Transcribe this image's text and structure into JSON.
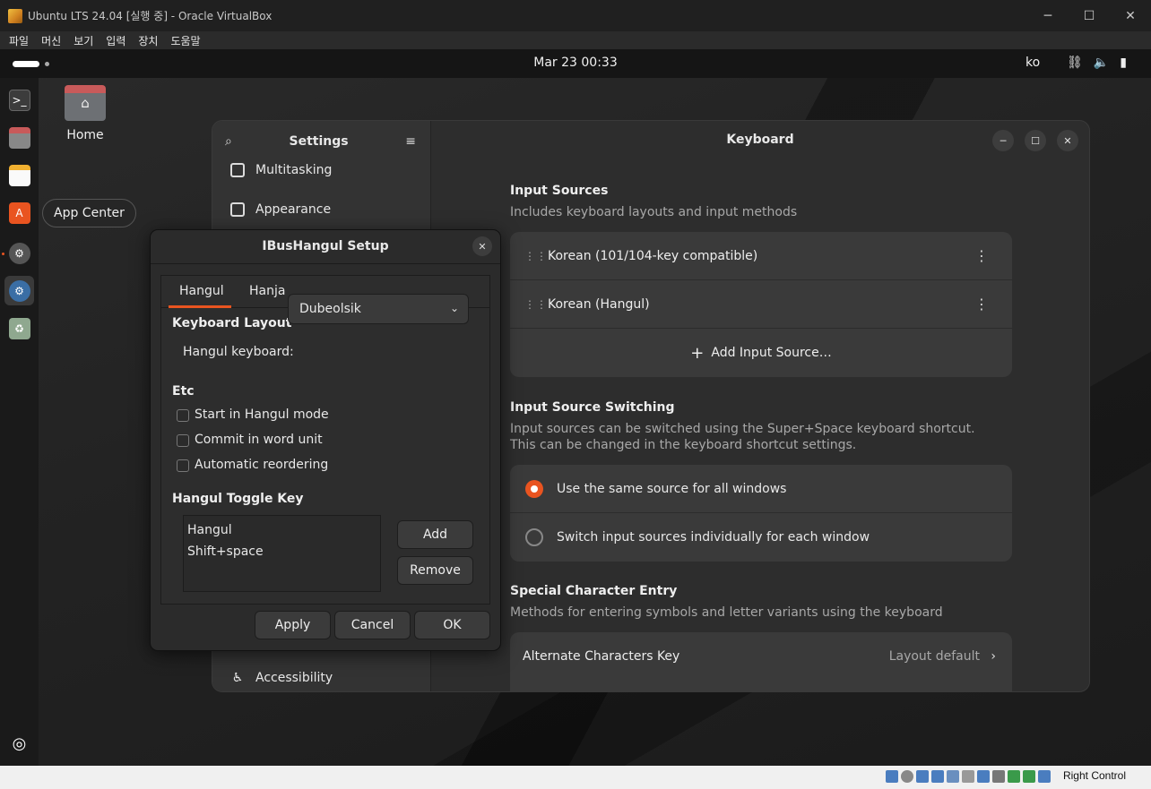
{
  "host": {
    "title": "Ubuntu LTS 24.04 [실행 중] - Oracle VirtualBox",
    "menu": [
      "파일",
      "머신",
      "보기",
      "입력",
      "장치",
      "도움말"
    ],
    "status_host_key": "Right Control",
    "win_min": "─",
    "win_max": "☐",
    "win_close": "✕"
  },
  "topbar": {
    "clock": "Mar 23  00:33",
    "lang": "ko",
    "icons": [
      "network-icon",
      "volume-icon",
      "battery-icon"
    ]
  },
  "desktop": {
    "home_label": "Home",
    "tooltip": "App Center"
  },
  "settings": {
    "sidebar_title": "Settings",
    "sidebar_items": [
      "Multitasking",
      "Appearance",
      "Accessibility"
    ],
    "page_title": "Keyboard",
    "input_sources": {
      "title": "Input Sources",
      "desc": "Includes keyboard layouts and input methods",
      "items": [
        "Korean (101/104-key compatible)",
        "Korean (Hangul)"
      ],
      "add_label": "Add Input Source…"
    },
    "switching": {
      "title": "Input Source Switching",
      "desc_line1": "Input sources can be switched using the Super+Space keyboard shortcut.",
      "desc_line2": "This can be changed in the keyboard shortcut settings.",
      "options": [
        "Use the same source for all windows",
        "Switch input sources individually for each window"
      ],
      "selected_index": 0
    },
    "special": {
      "title": "Special Character Entry",
      "desc": "Methods for entering symbols and letter variants using the keyboard",
      "alt_key_label": "Alternate Characters Key",
      "alt_key_value": "Layout default"
    }
  },
  "ibus": {
    "title": "IBusHangul Setup",
    "tabs": [
      "Hangul",
      "Hanja"
    ],
    "active_tab": "Hangul",
    "keyboard_layout_heading": "Keyboard Layout",
    "hangul_keyboard_label": "Hangul keyboard:",
    "hangul_keyboard_value": "Dubeolsik",
    "etc_heading": "Etc",
    "options": [
      {
        "label": "Start in Hangul mode",
        "checked": false
      },
      {
        "label": "Commit in word unit",
        "checked": false
      },
      {
        "label": "Automatic reordering",
        "checked": false
      }
    ],
    "toggle_heading": "Hangul Toggle Key",
    "toggle_keys": [
      "Hangul",
      "Shift+space"
    ],
    "add_label": "Add",
    "remove_label": "Remove",
    "apply_label": "Apply",
    "cancel_label": "Cancel",
    "ok_label": "OK"
  },
  "colors": {
    "accent": "#e95420",
    "window_bg": "#2d2d2d",
    "card_bg": "#3a3a3a"
  }
}
